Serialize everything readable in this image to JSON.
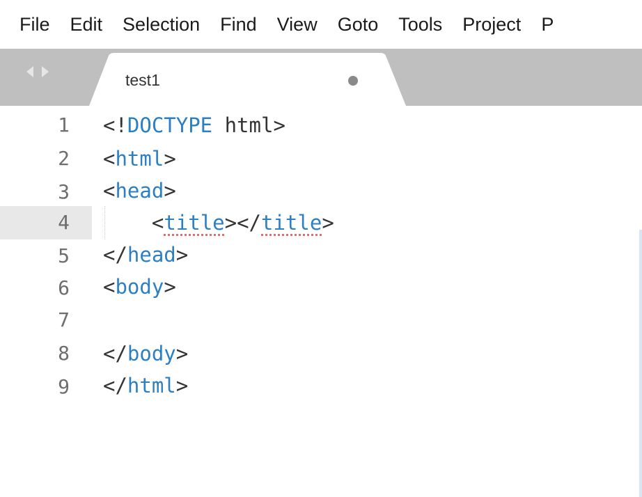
{
  "menu": {
    "items": [
      "File",
      "Edit",
      "Selection",
      "Find",
      "View",
      "Goto",
      "Tools",
      "Project",
      "P"
    ]
  },
  "tabs": {
    "active": {
      "label": "test1",
      "unsaved_indicator": "dirty-dot"
    }
  },
  "colors": {
    "tag": "#2b7fc2",
    "punct": "#333333",
    "tab_bar": "#bfbfbf",
    "current_line": "#e8e8e8"
  },
  "editor": {
    "current_line": 4,
    "lines": [
      {
        "number": "1",
        "text": "<!DOCTYPE html>"
      },
      {
        "number": "2",
        "text": "<html>"
      },
      {
        "number": "3",
        "text": "<head>"
      },
      {
        "number": "4",
        "text": "    <title></title>"
      },
      {
        "number": "5",
        "text": "</head>"
      },
      {
        "number": "6",
        "text": "<body>"
      },
      {
        "number": "7",
        "text": ""
      },
      {
        "number": "8",
        "text": "</body>"
      },
      {
        "number": "9",
        "text": "</html>"
      }
    ]
  }
}
